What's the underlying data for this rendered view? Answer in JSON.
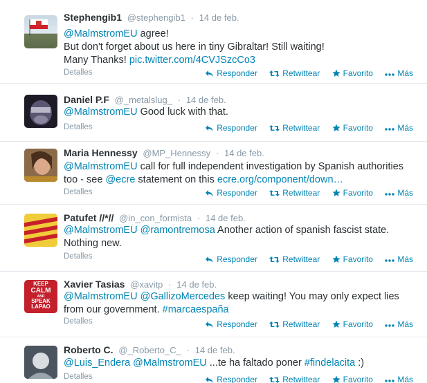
{
  "tweets": [
    {
      "fullname": "Stephengib1",
      "username": "@stephengib1",
      "time": "14 de feb.",
      "line1_mention": "@MalmstromEU",
      "line1_rest": " agree!",
      "line2": "But don't forget about us here in tiny Gibraltar! Still waiting!",
      "line3_text": "Many Thanks! ",
      "line3_link": "pic.twitter.com/4CVJSzcCo3",
      "details": "Detalles"
    },
    {
      "fullname": "Daniel P.F",
      "username": "@_metalslug_",
      "time": "14 de feb.",
      "line1_mention": "@MalmstromEU",
      "line1_rest": " Good luck with that.",
      "details": "Detalles"
    },
    {
      "fullname": "Maria Hennessy",
      "username": "@MP_Hennessy",
      "time": "14 de feb.",
      "line1_mention": "@MalmstromEU",
      "line1_rest": " call for full independent investigation by Spanish authorities",
      "line2_pre": "too - see ",
      "line2_mention": "@ecre",
      "line2_mid": " statement on this ",
      "line2_link": "ecre.org/component/down…",
      "details": "Detalles"
    },
    {
      "fullname": "Patufet //*//",
      "username": "@in_con_formista",
      "time": "14 de feb.",
      "line1_mention1": "@MalmstromEU",
      "line1_mention2": "@ramontremosa",
      "line1_rest": " Another action of spanish fascist state.",
      "line2": "Nothing new.",
      "details": "Detalles"
    },
    {
      "fullname": "Xavier Tasias",
      "username": "@xavitp",
      "time": "14 de feb.",
      "line1_mention1": "@MalmstromEU",
      "line1_mention2": "@GallizoMercedes",
      "line1_rest": " keep waiting! You may only expect lies",
      "line2_text": "from our government. ",
      "line2_hashtag": "#marcaespaña",
      "details": "Detalles",
      "avatar_text": [
        "KEEP",
        "CALM",
        "AND",
        "SPEAK",
        "LAPAO"
      ]
    },
    {
      "fullname": "Roberto C.",
      "username": "@_Roberto_C_",
      "time": "14 de feb.",
      "line1_mention1": "@Luis_Endera",
      "line1_mention2": "@MalmstromEU",
      "line1_rest": " ...te ha faltado poner ",
      "line1_hashtag": "#findelacita",
      "line1_end": " :)",
      "details": "Detalles"
    }
  ],
  "actions": {
    "reply": "Responder",
    "retweet": "Retwittear",
    "favorite": "Favorito",
    "more": "Más"
  },
  "icons": {
    "reply": "reply-icon",
    "retweet": "retweet-icon",
    "favorite": "star-icon",
    "more": "more-dots-icon"
  },
  "colors": {
    "link": "#0084b4",
    "meta": "#8899a6",
    "text": "#292f33",
    "border": "#e1e8ed"
  }
}
